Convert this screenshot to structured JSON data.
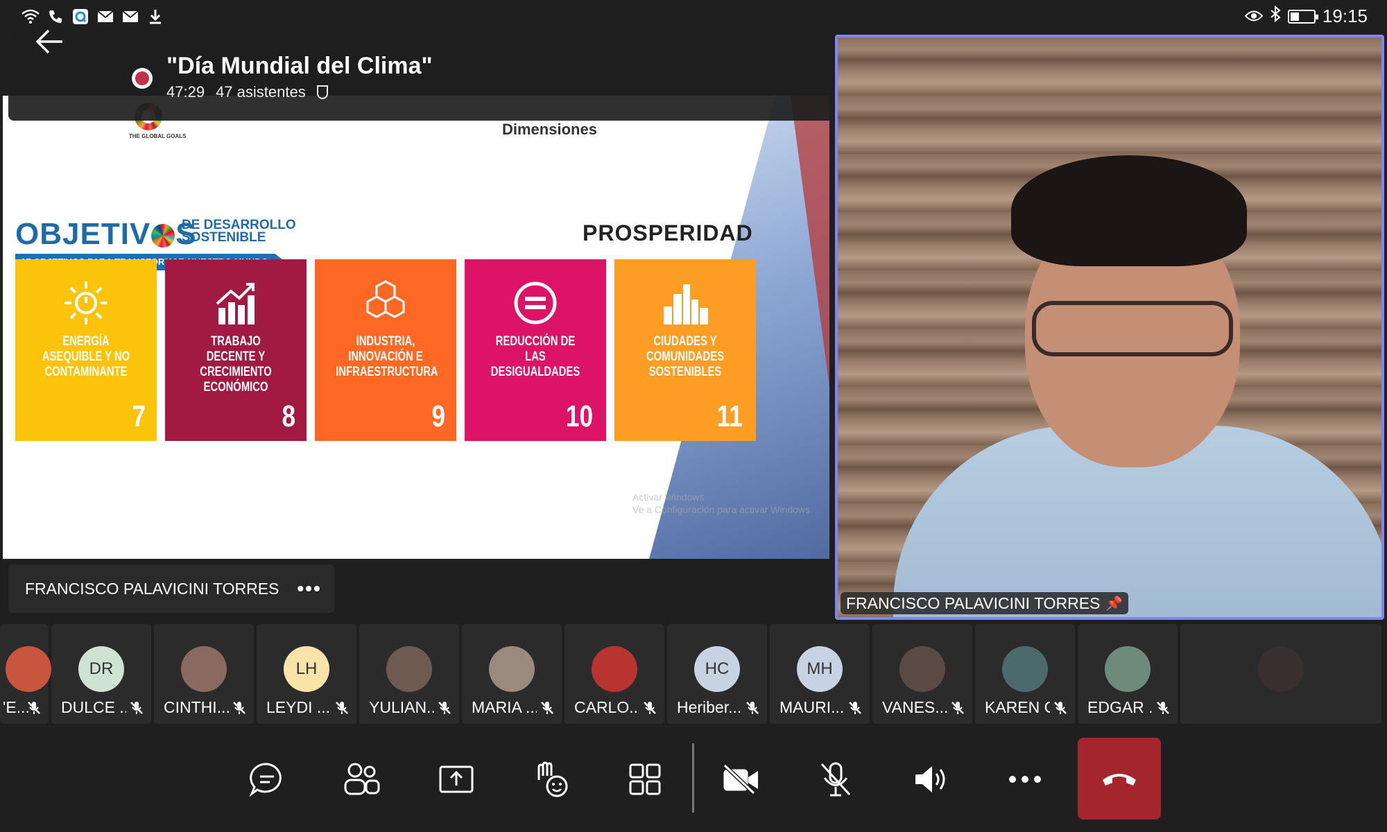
{
  "status_bar": {
    "time": "19:15",
    "left_icons": [
      "wifi-icon",
      "phone-icon",
      "app-icon",
      "mail-icon",
      "mail-icon",
      "download-icon"
    ],
    "right_icons": [
      "eye-icon",
      "bluetooth-icon",
      "battery-icon"
    ]
  },
  "meeting": {
    "title": "\"Día Mundial del Clima\"",
    "duration": "47:29",
    "attendees": "47 asistentes",
    "recording_color": "#c4314b"
  },
  "slide": {
    "header": "Dimensiones",
    "logo_text": "THE GLOBAL GOALS",
    "ods_title_prefix": "OBJETIV",
    "ods_title_suffix": "S",
    "ods_subtitle_1": "DE DESARROLLO",
    "ods_subtitle_2": "SOSTENIBLE",
    "ods_banner": "17 OBJETIVOS PARA TRANSFORMAR NUESTRO MUNDO",
    "dimension": "PROSPERIDAD",
    "tiles": [
      {
        "label": "ENERGÍA ASEQUIBLE Y NO CONTAMINANTE",
        "number": "7",
        "color": "#fcc30b",
        "icon": "sun-power-icon"
      },
      {
        "label": "TRABAJO DECENTE Y CRECIMIENTO ECONÓMICO",
        "number": "8",
        "color": "#a21942",
        "icon": "growth-chart-icon"
      },
      {
        "label": "INDUSTRIA, INNOVACIÓN E INFRAESTRUCTURA",
        "number": "9",
        "color": "#fd6925",
        "icon": "cubes-icon"
      },
      {
        "label": "REDUCCIÓN DE LAS DESIGUALDADES",
        "number": "10",
        "color": "#dd1367",
        "icon": "equals-icon"
      },
      {
        "label": "CIUDADES Y COMUNIDADES SOSTENIBLES",
        "number": "11",
        "color": "#fd9d24",
        "icon": "city-icon"
      }
    ],
    "watermark_1": "Activar Windows",
    "watermark_2": "Ve a Configuración para activar Windows.",
    "presenter": "FRANCISCO PALAVICINI TORRES"
  },
  "speaker": {
    "name": "FRANCISCO PALAVICINI TORRES",
    "border_color": "#7f85f5"
  },
  "participants": [
    {
      "name": "'E...",
      "initials": "",
      "avatar_color": "#c8553d",
      "photo": true
    },
    {
      "name": "DULCE ...",
      "initials": "DR",
      "avatar_color": "#cfe3d2",
      "photo": false
    },
    {
      "name": "CINTHI...",
      "initials": "",
      "avatar_color": "#8a6a60",
      "photo": true
    },
    {
      "name": "LEYDI ...",
      "initials": "LH",
      "avatar_color": "#f8e3a8",
      "photo": false
    },
    {
      "name": "YULIAN...",
      "initials": "",
      "avatar_color": "#6f5a52",
      "photo": true
    },
    {
      "name": "MARIA ...",
      "initials": "",
      "avatar_color": "#9a8a7e",
      "photo": true
    },
    {
      "name": "CARLO...",
      "initials": "",
      "avatar_color": "#b8352f",
      "photo": true
    },
    {
      "name": "Heriber...",
      "initials": "HC",
      "avatar_color": "#c7d3e3",
      "photo": false
    },
    {
      "name": "MAURI...",
      "initials": "MH",
      "avatar_color": "#c7d3e3",
      "photo": false
    },
    {
      "name": "VANES...",
      "initials": "",
      "avatar_color": "#5b4a44",
      "photo": true
    },
    {
      "name": "KAREN G",
      "initials": "",
      "avatar_color": "#4c6a6e",
      "photo": true
    },
    {
      "name": "EDGAR ...",
      "initials": "",
      "avatar_color": "#6d8a7a",
      "photo": true
    },
    {
      "name": "",
      "initials": "",
      "avatar_color": "#3a2f2f",
      "photo": true
    }
  ],
  "toolbar": {
    "buttons": [
      "chat-icon",
      "participants-icon",
      "share-tray-icon",
      "reactions-icon",
      "view-grid-icon",
      "camera-off-icon",
      "mic-off-icon",
      "speaker-icon",
      "more-options-icon",
      "hang-up-icon"
    ],
    "hangup_color": "#a4262c"
  }
}
